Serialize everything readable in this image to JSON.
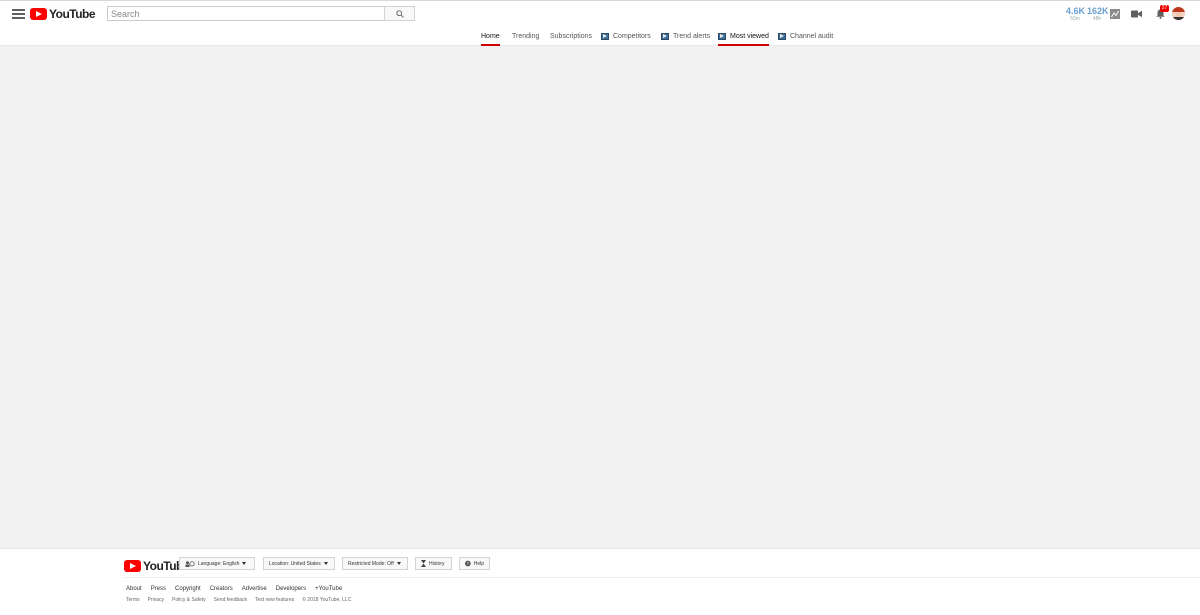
{
  "masthead": {
    "logo_text": "YouTube",
    "search": {
      "placeholder": "Search",
      "value": ""
    },
    "stats": [
      {
        "value": "4.6K",
        "label": "50m"
      },
      {
        "value": "162K",
        "label": "48h"
      }
    ],
    "notification_count": "27"
  },
  "tabs": [
    {
      "label": "Home",
      "active": true
    },
    {
      "label": "Trending"
    },
    {
      "label": "Subscriptions"
    },
    {
      "label": "Competitors",
      "extension": true
    },
    {
      "label": "Trend alerts",
      "extension": true
    },
    {
      "label": "Most viewed",
      "extension": true,
      "active": true
    },
    {
      "label": "Channel audit",
      "extension": true
    }
  ],
  "colors": {
    "brand_red": "#ff0000",
    "active_tab_underline": "#cc0000",
    "stat_blue": "#6a9fd0"
  },
  "footer": {
    "logo_text": "YouTube",
    "language": "Language: English",
    "location": "Location: United States",
    "restricted": "Restricted Mode: Off",
    "history": "History",
    "help": "Help",
    "links": [
      "About",
      "Press",
      "Copyright",
      "Creators",
      "Advertise",
      "Developers",
      "+YouTube"
    ],
    "small_links": [
      "Terms",
      "Privacy",
      "Policy & Safety",
      "Send feedback",
      "Test new features",
      "© 2018 YouTube, LLC"
    ]
  }
}
